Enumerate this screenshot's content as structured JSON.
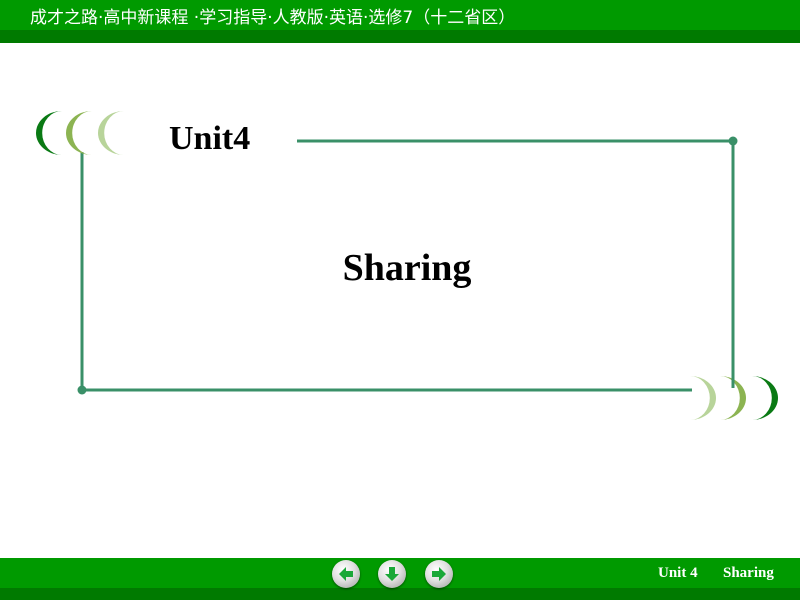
{
  "header": {
    "title": "成才之路·高中新课程 ·学习指导·人教版·英语·选修7（十二省区）"
  },
  "slide": {
    "unit_label": "Unit4",
    "title": "Sharing"
  },
  "footer": {
    "unit": "Unit 4",
    "topic": "Sharing",
    "nav": {
      "prev_icon": "arrow-left-icon",
      "home_icon": "arrow-down-icon",
      "next_icon": "arrow-right-icon"
    }
  },
  "colors": {
    "header_green": "#009a00",
    "header_dark_green": "#007a00",
    "frame_line": "#3a9068",
    "crescent_dark": "#0a7a14",
    "crescent_mid": "#8cb452",
    "crescent_light": "#b8d49a",
    "arrow_green": "#1aa838"
  }
}
